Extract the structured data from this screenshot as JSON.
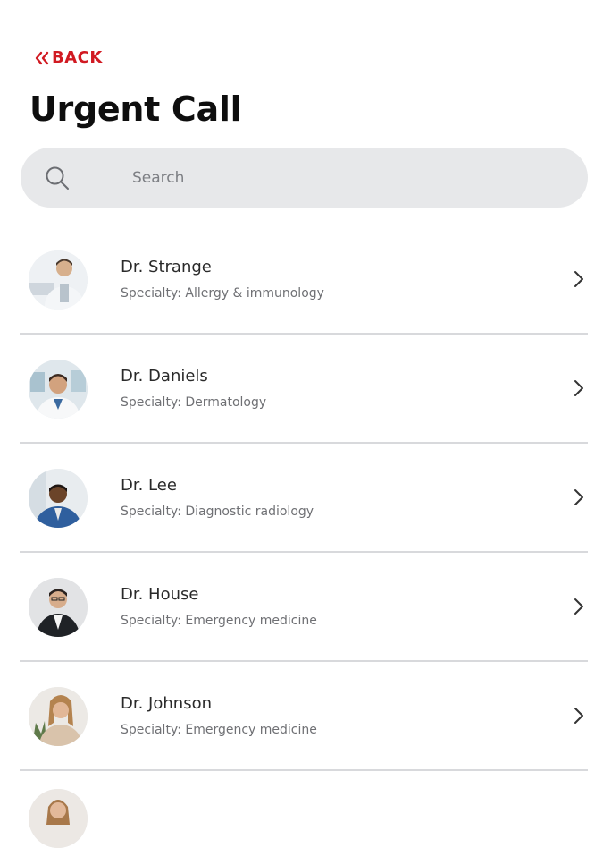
{
  "header": {
    "back_label": "BACK",
    "back_icon": "double-chevron-left-icon",
    "title": "Urgent Call"
  },
  "search": {
    "placeholder": "Search",
    "value": "",
    "icon": "search-icon"
  },
  "colors": {
    "accent": "#d11a22",
    "search_bg": "#e7e8ea",
    "divider": "#d8d9dc",
    "subtext": "#6f7074"
  },
  "doctors": [
    {
      "name": "Dr. Strange",
      "specialty": "Specialty: Allergy & immunology"
    },
    {
      "name": "Dr. Daniels",
      "specialty": "Specialty: Dermatology"
    },
    {
      "name": "Dr. Lee",
      "specialty": "Specialty: Diagnostic radiology"
    },
    {
      "name": "Dr. House",
      "specialty": "Specialty: Emergency medicine"
    },
    {
      "name": "Dr. Johnson",
      "specialty": "Specialty: Emergency medicine"
    }
  ]
}
